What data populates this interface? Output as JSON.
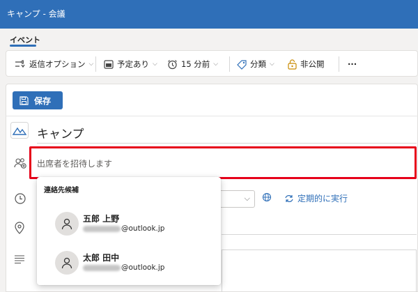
{
  "window": {
    "title": "キャンプ - 会議"
  },
  "tabs": [
    {
      "label": "イベント",
      "active": true
    }
  ],
  "ribbon": {
    "reply_options": "返信オプション",
    "busy_status": "予定あり",
    "reminder": "15 分前",
    "categorize": "分類",
    "private": "非公開",
    "more": "···"
  },
  "form": {
    "save_label": "保存",
    "event_title": "キャンプ",
    "invite_placeholder": "出席者を招待します",
    "recurring_label": "定期的に実行"
  },
  "suggestions": {
    "header": "連絡先候補",
    "contacts": [
      {
        "name": "五郎 上野",
        "email_suffix": "@outlook.jp"
      },
      {
        "name": "太郎 田中",
        "email_suffix": "@outlook.jp"
      }
    ]
  },
  "colors": {
    "accent": "#2f6fb8",
    "highlight_border": "#e6001a"
  },
  "icons": [
    "reply-options-icon",
    "calendar-status-icon",
    "alarm-clock-icon",
    "tag-icon",
    "lock-icon",
    "save-icon",
    "event-title-icon",
    "attendees-icon",
    "clock-icon",
    "location-icon",
    "body-text-icon",
    "globe-icon",
    "recurring-icon",
    "person-icon"
  ]
}
